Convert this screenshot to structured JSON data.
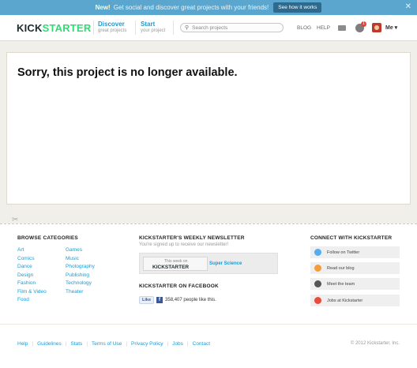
{
  "notice": {
    "new_label": "New!",
    "message": "Get social and discover great projects with your friends!",
    "button": "See how it works",
    "close": "✕"
  },
  "header": {
    "logo_part1": "KICK",
    "logo_part2": "STARTER",
    "discover_title": "Discover",
    "discover_sub": "great projects",
    "start_title": "Start",
    "start_sub": "your project",
    "search_placeholder": "Search projects",
    "blog": "BLOG",
    "help": "HELP",
    "notification_count": "1",
    "me": "Me ▾"
  },
  "main": {
    "heading": "Sorry, this project is no longer available."
  },
  "footer": {
    "browse_title": "BROWSE CATEGORIES",
    "categories_col1": [
      "Art",
      "Comics",
      "Dance",
      "Design",
      "Fashion",
      "Film & Video",
      "Food"
    ],
    "categories_col2": [
      "Games",
      "Music",
      "Photography",
      "Publishing",
      "Technology",
      "Theater"
    ],
    "newsletter_title": "KICKSTARTER'S WEEKLY NEWSLETTER",
    "newsletter_sub": "You're signed up to receive our newsletter!",
    "newsletter_box_top": "This week on",
    "newsletter_box_logo": "KICKSTARTER",
    "newsletter_box_feature": "Super Science",
    "facebook_title": "KICKSTARTER ON FACEBOOK",
    "facebook_like": "Like",
    "facebook_count": "358,407 people like this.",
    "connect_title": "CONNECT WITH KICKSTARTER",
    "connect_items": [
      {
        "label": "Follow on Twitter",
        "color": "#55acee"
      },
      {
        "label": "Read our blog",
        "color": "#f39c3c"
      },
      {
        "label": "Meet the team",
        "color": "#555555"
      },
      {
        "label": "Jobs at Kickstarter",
        "color": "#e74c3c"
      }
    ],
    "links": [
      "Help",
      "Guidelines",
      "Stats",
      "Terms of Use",
      "Privacy Policy",
      "Jobs",
      "Contact"
    ],
    "copyright": "© 2012 Kickstarter, Inc."
  }
}
